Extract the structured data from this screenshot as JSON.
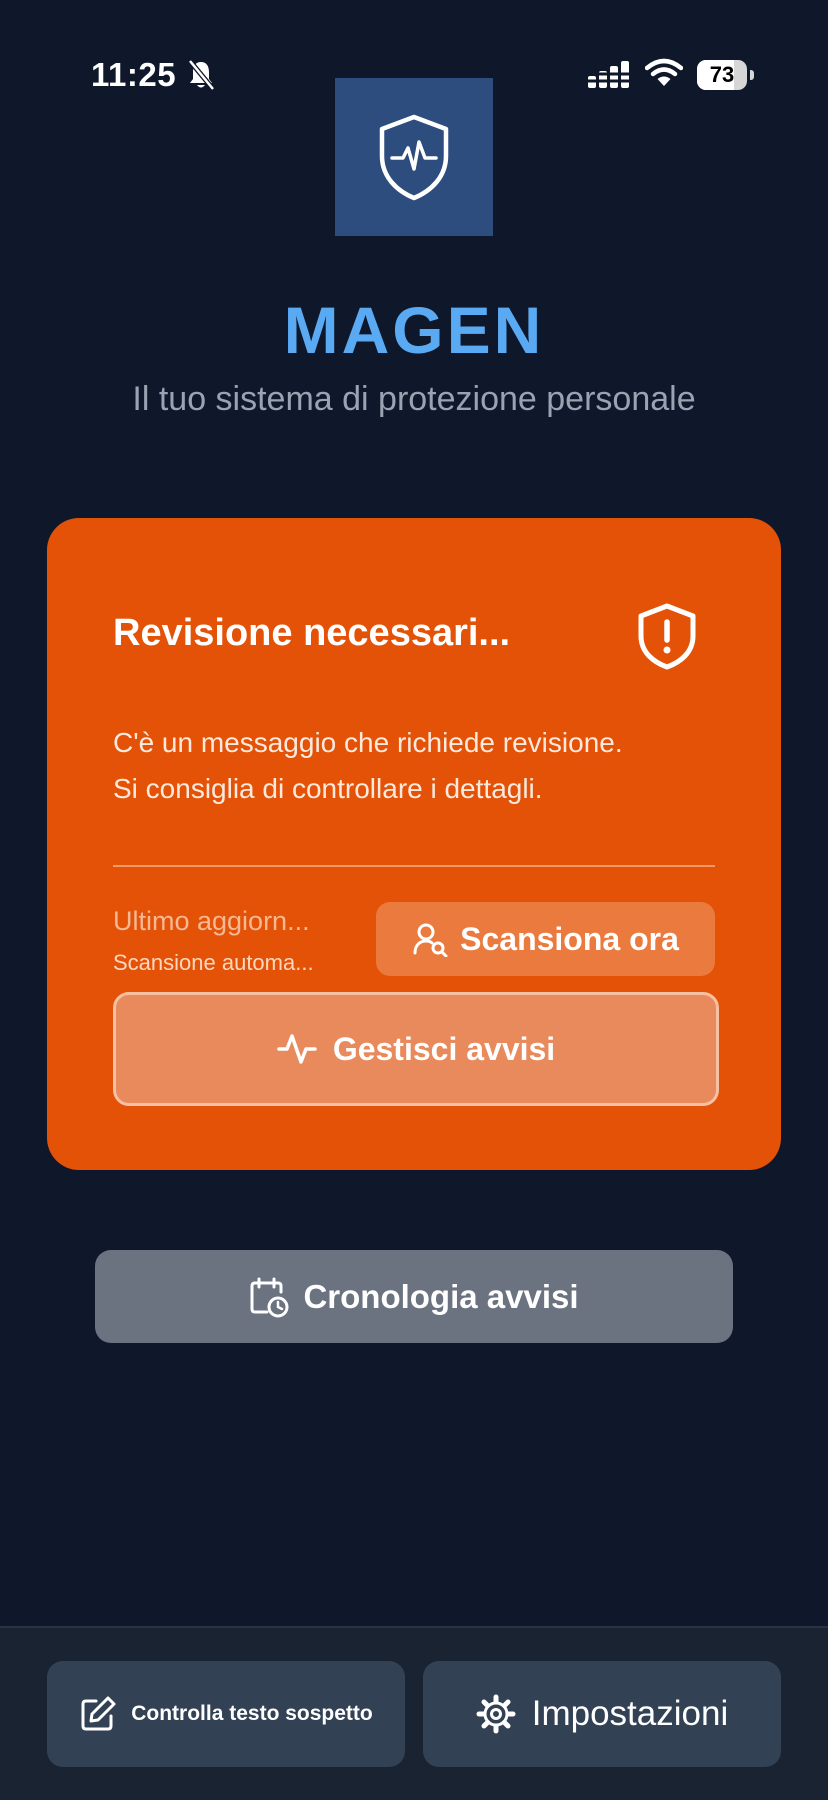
{
  "status_bar": {
    "time": "11:25",
    "battery": "73",
    "battery_level_percent": 73,
    "icons": [
      "bell-slash-icon",
      "signal-icon",
      "wifi-icon",
      "battery-icon"
    ]
  },
  "app": {
    "logo_icon": "shield-heartbeat-icon",
    "title": "MAGEN",
    "subtitle": "Il tuo sistema di protezione personale"
  },
  "status_card": {
    "title": "Revisione necessari...",
    "icon": "shield-alert-icon",
    "message_line1": "C'è un messaggio che richiede revisione.",
    "message_line2": "Si consiglia di controllare i dettagli.",
    "last_update": "Ultimo aggiorn...",
    "auto_scan": "Scansione automa...",
    "scan_button": {
      "label": "Scansiona ora",
      "icon": "user-search-icon"
    },
    "manage_button": {
      "label": "Gestisci avvisi",
      "icon": "activity-icon"
    }
  },
  "history_button": {
    "label": "Cronologia avvisi",
    "icon": "calendar-clock-icon"
  },
  "bottom_bar": {
    "check_text_button": {
      "label": "Controlla testo sospetto",
      "icon": "edit-icon"
    },
    "settings_button": {
      "label": "Impostazioni",
      "icon": "gear-icon"
    }
  },
  "colors": {
    "background": "#0f172a",
    "card": "#e35206",
    "title_accent": "#5aaaf3",
    "history_button": "#6b7280",
    "bottom_button": "#334155"
  }
}
